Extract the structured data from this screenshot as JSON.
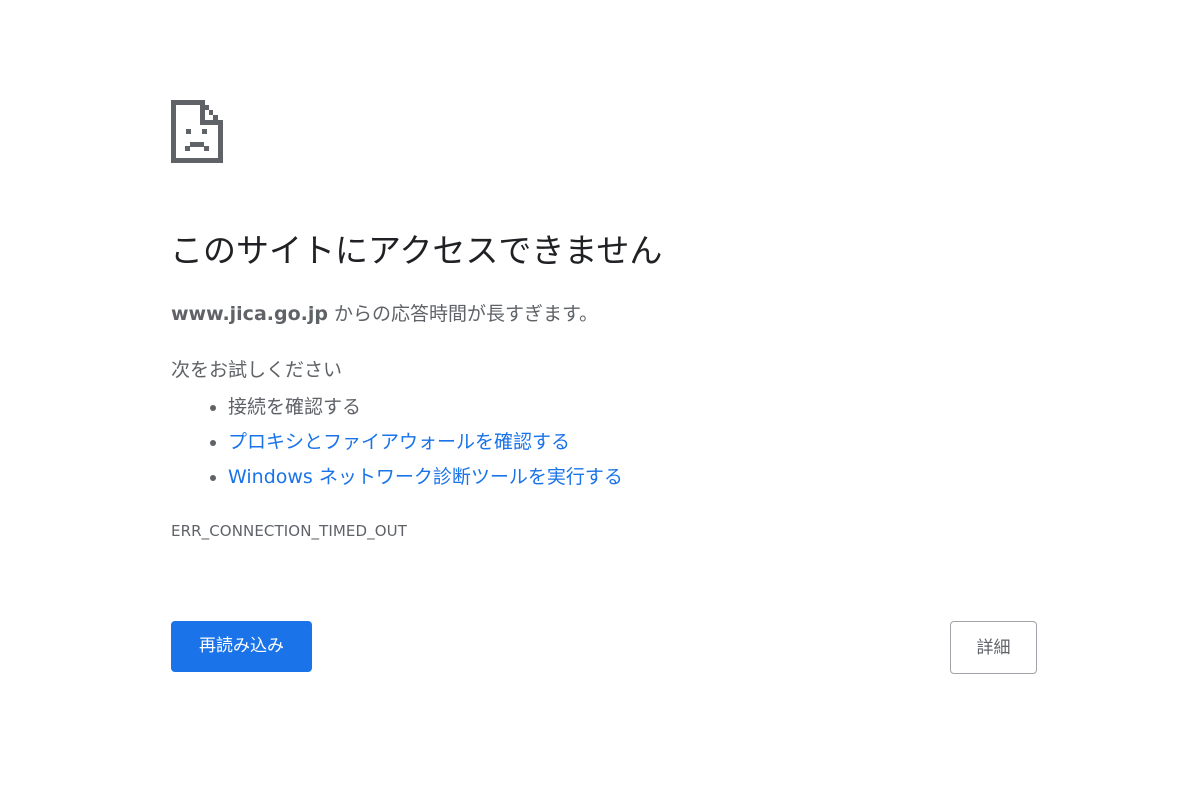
{
  "icon": "sad-document-icon",
  "colors": {
    "accent": "#1a73e8",
    "text_primary": "#202124",
    "text_secondary": "#5f6368",
    "icon": "#5f6368"
  },
  "title": "このサイトにアクセスできません",
  "summary": {
    "host": "www.jica.go.jp",
    "message": " からの応答時間が長すぎます。"
  },
  "suggestions": {
    "heading": "次をお試しください",
    "items": [
      {
        "label": "接続を確認する",
        "is_link": false
      },
      {
        "label": "プロキシとファイアウォールを確認する",
        "is_link": true
      },
      {
        "label": "Windows ネットワーク診断ツールを実行する",
        "is_link": true
      }
    ]
  },
  "error_code": "ERR_CONNECTION_TIMED_OUT",
  "buttons": {
    "reload": "再読み込み",
    "details": "詳細"
  }
}
